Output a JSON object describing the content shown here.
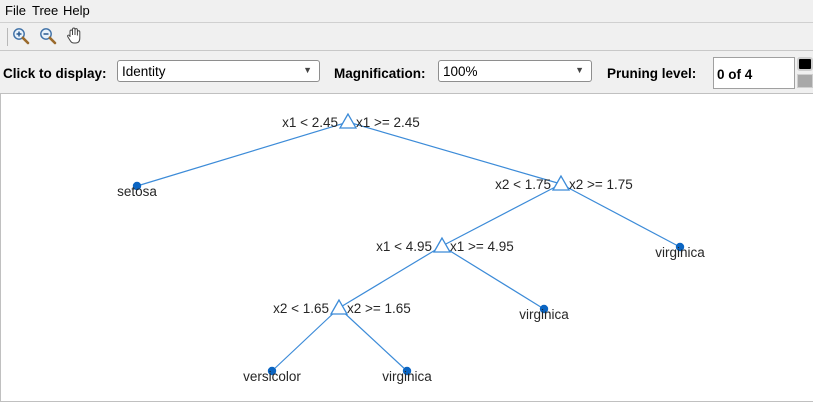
{
  "menubar": {
    "items": [
      "File",
      "Tree",
      "Help"
    ]
  },
  "toolbar": {
    "tools": [
      {
        "icon": "zoom-in-icon",
        "label": ""
      },
      {
        "icon": "zoom-out-icon",
        "label": ""
      },
      {
        "icon": "pan-hand-icon",
        "label": ""
      }
    ]
  },
  "controls": {
    "display_label": "Click to display:",
    "display_value": "Identity",
    "magnification_label": "Magnification:",
    "magnification_value": "100%",
    "pruning_label": "Pruning level:",
    "pruning_value": "0 of 4"
  },
  "colors": {
    "line": "#3c8bd8",
    "leaf": "#0b65c2",
    "text": "#262626"
  },
  "tree": {
    "nodes": [
      {
        "id": "n1",
        "type": "split",
        "left_text": "x1 < 2.45",
        "right_text": "x1 >= 2.45"
      },
      {
        "id": "n2",
        "type": "leaf",
        "label": "setosa"
      },
      {
        "id": "n3",
        "type": "split",
        "left_text": "x2 < 1.75",
        "right_text": "x2 >= 1.75"
      },
      {
        "id": "n4",
        "type": "split",
        "left_text": "x1 < 4.95",
        "right_text": "x1 >= 4.95"
      },
      {
        "id": "n5",
        "type": "leaf",
        "label": "virginica"
      },
      {
        "id": "n6",
        "type": "split",
        "left_text": "x2 < 1.65",
        "right_text": "x2 >= 1.65"
      },
      {
        "id": "n7",
        "type": "leaf",
        "label": "virginica"
      },
      {
        "id": "n8",
        "type": "leaf",
        "label": "versicolor"
      },
      {
        "id": "n9",
        "type": "leaf",
        "label": "virginica"
      }
    ],
    "edges": [
      [
        "n1",
        "n2"
      ],
      [
        "n1",
        "n3"
      ],
      [
        "n3",
        "n4"
      ],
      [
        "n3",
        "n5"
      ],
      [
        "n4",
        "n6"
      ],
      [
        "n4",
        "n7"
      ],
      [
        "n6",
        "n8"
      ],
      [
        "n6",
        "n9"
      ]
    ]
  }
}
